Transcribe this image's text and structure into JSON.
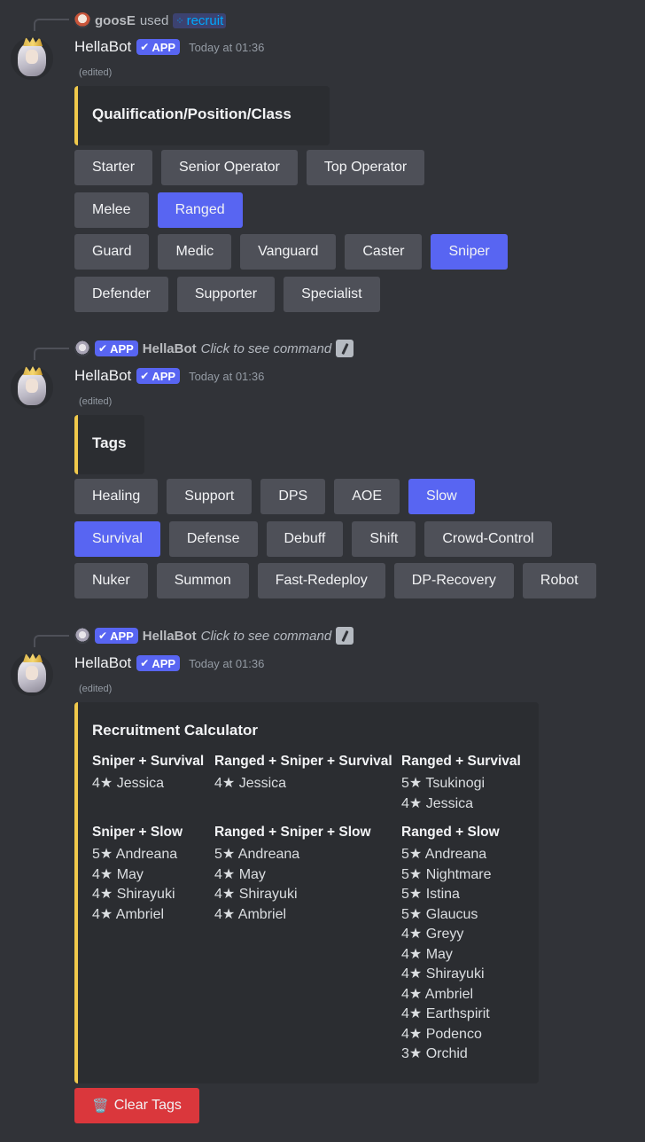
{
  "messages": [
    {
      "reply": {
        "user": "goosE",
        "verb": "used",
        "command": "recruit",
        "command_icon": "app-grid-icon"
      },
      "author": "HellaBot",
      "badge": "APP",
      "timestamp": "Today at 01:36",
      "edited": "(edited)",
      "embed_title": "Qualification/Position/Class",
      "button_rows": [
        [
          {
            "label": "Starter",
            "active": false
          },
          {
            "label": "Senior Operator",
            "active": false
          },
          {
            "label": "Top Operator",
            "active": false
          }
        ],
        [
          {
            "label": "Melee",
            "active": false
          },
          {
            "label": "Ranged",
            "active": true
          }
        ],
        [
          {
            "label": "Guard",
            "active": false
          },
          {
            "label": "Medic",
            "active": false
          },
          {
            "label": "Vanguard",
            "active": false
          },
          {
            "label": "Caster",
            "active": false
          },
          {
            "label": "Sniper",
            "active": true
          }
        ],
        [
          {
            "label": "Defender",
            "active": false
          },
          {
            "label": "Supporter",
            "active": false
          },
          {
            "label": "Specialist",
            "active": false
          }
        ]
      ]
    },
    {
      "reply": {
        "badge": "APP",
        "user": "HellaBot",
        "text": "Click to see command"
      },
      "author": "HellaBot",
      "badge": "APP",
      "timestamp": "Today at 01:36",
      "edited": "(edited)",
      "embed_title": "Tags",
      "button_rows": [
        [
          {
            "label": "Healing",
            "active": false
          },
          {
            "label": "Support",
            "active": false
          },
          {
            "label": "DPS",
            "active": false
          },
          {
            "label": "AOE",
            "active": false
          },
          {
            "label": "Slow",
            "active": true
          }
        ],
        [
          {
            "label": "Survival",
            "active": true
          },
          {
            "label": "Defense",
            "active": false
          },
          {
            "label": "Debuff",
            "active": false
          },
          {
            "label": "Shift",
            "active": false
          },
          {
            "label": "Crowd-Control",
            "active": false
          }
        ],
        [
          {
            "label": "Nuker",
            "active": false
          },
          {
            "label": "Summon",
            "active": false
          },
          {
            "label": "Fast-Redeploy",
            "active": false
          },
          {
            "label": "DP-Recovery",
            "active": false
          },
          {
            "label": "Robot",
            "active": false
          }
        ]
      ]
    },
    {
      "reply": {
        "badge": "APP",
        "user": "HellaBot",
        "text": "Click to see command"
      },
      "author": "HellaBot",
      "badge": "APP",
      "timestamp": "Today at 01:36",
      "edited": "(edited)",
      "embed_title": "Recruitment Calculator",
      "calc_columns": [
        [
          {
            "head": "Sniper + Survival",
            "lines": [
              "4★ Jessica"
            ]
          },
          {
            "head": "Sniper + Slow",
            "lines": [
              "5★ Andreana",
              "4★ May",
              "4★ Shirayuki",
              "4★ Ambriel"
            ]
          }
        ],
        [
          {
            "head": "Ranged + Sniper + Survival",
            "lines": [
              "4★ Jessica"
            ]
          },
          {
            "head": "Ranged + Sniper + Slow",
            "lines": [
              "5★ Andreana",
              "4★ May",
              "4★ Shirayuki",
              "4★ Ambriel"
            ]
          }
        ],
        [
          {
            "head": "Ranged + Survival",
            "lines": [
              "5★ Tsukinogi",
              "4★ Jessica"
            ]
          },
          {
            "head": "Ranged + Slow",
            "lines": [
              "5★ Andreana",
              "5★ Nightmare",
              "5★ Istina",
              "5★ Glaucus",
              "4★ Greyy",
              "4★ May",
              "4★ Shirayuki",
              "4★ Ambriel",
              "4★ Earthspirit",
              "4★ Podenco",
              "3★ Orchid"
            ]
          }
        ]
      ],
      "clear_button": {
        "label": "Clear Tags",
        "icon": "trash-icon",
        "emoji": "🗑️"
      }
    }
  ],
  "colors": {
    "background": "#313338",
    "embed_bg": "#2b2d31",
    "embed_accent": "#f0c94b",
    "primary": "#5865f2",
    "secondary": "#4e5058",
    "danger": "#da373c",
    "link": "#00a8fc"
  }
}
